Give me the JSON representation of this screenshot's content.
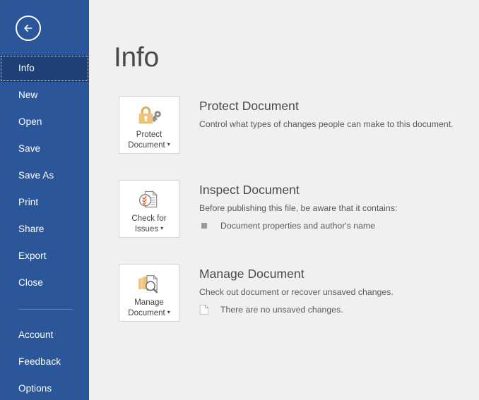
{
  "window": {
    "app": "Word",
    "screen": "Backstage"
  },
  "sidebar": {
    "back_icon": "back-arrow-icon",
    "accent_color": "#2b579a",
    "selected_color": "#1e4076",
    "items": [
      {
        "label": "Info",
        "selected": true
      },
      {
        "label": "New",
        "selected": false
      },
      {
        "label": "Open",
        "selected": false
      },
      {
        "label": "Save",
        "selected": false
      },
      {
        "label": "Save As",
        "selected": false
      },
      {
        "label": "Print",
        "selected": false
      },
      {
        "label": "Share",
        "selected": false
      },
      {
        "label": "Export",
        "selected": false
      },
      {
        "label": "Close",
        "selected": false
      }
    ],
    "bottom_items": [
      {
        "label": "Account"
      },
      {
        "label": "Feedback"
      },
      {
        "label": "Options"
      }
    ]
  },
  "main": {
    "title": "Info",
    "sections": [
      {
        "button_label": "Protect\nDocument",
        "button_icon": "padlock-key-icon",
        "heading": "Protect Document",
        "description": "Control what types of changes people can make to this document.",
        "bullets": []
      },
      {
        "button_label": "Check for\nIssues",
        "button_icon": "document-inspect-icon",
        "heading": "Inspect Document",
        "description": "Before publishing this file, be aware that it contains:",
        "bullets": [
          {
            "icon": "square-bullet-icon",
            "text": "Document properties and author's name"
          }
        ]
      },
      {
        "button_label": "Manage\nDocument",
        "button_icon": "document-stack-magnifier-icon",
        "heading": "Manage Document",
        "description": "Check out document or recover unsaved changes.",
        "bullets": [
          {
            "icon": "dotted-document-icon",
            "text": "There are no unsaved changes."
          }
        ]
      }
    ]
  },
  "colors": {
    "sidebar_blue": "#2b579a",
    "selected_blue": "#1e4076",
    "content_bg": "#f0f0f0",
    "button_bg": "#ffffff",
    "button_border": "#d4d4d4",
    "heading_text": "#4a4a4a",
    "body_text": "#5a5a5a",
    "icon_gold": "#e8c07a",
    "icon_gray": "#8a8a8a",
    "icon_orange": "#e8622c"
  }
}
